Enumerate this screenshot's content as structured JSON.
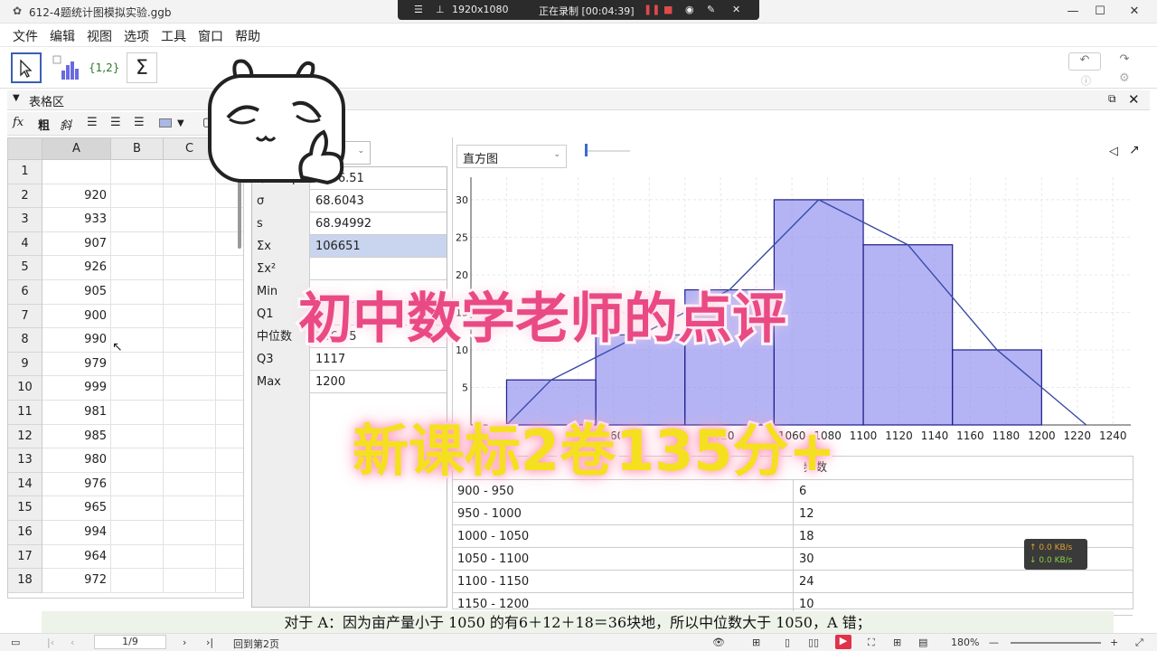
{
  "window": {
    "title": "612-4题统计图模拟实验.ggb",
    "controls": [
      "—",
      "☐",
      "✕"
    ]
  },
  "recording": {
    "resolution": "1920x1080",
    "status": "正在录制 [00:04:39]"
  },
  "menu": [
    "文件",
    "编辑",
    "视图",
    "选项",
    "工具",
    "窗口",
    "帮助"
  ],
  "toolbar": {
    "list_tool_label": "{1,2}",
    "sum_tool_label": "Σ"
  },
  "panel": {
    "title": "表格区",
    "format_fx": "fx",
    "format_bold": "粗",
    "format_italic": "斜"
  },
  "spreadsheet": {
    "columns": [
      "A",
      "B",
      "C"
    ],
    "rows": [
      {
        "n": "1",
        "a": ""
      },
      {
        "n": "2",
        "a": "920"
      },
      {
        "n": "3",
        "a": "933"
      },
      {
        "n": "4",
        "a": "907"
      },
      {
        "n": "5",
        "a": "926"
      },
      {
        "n": "6",
        "a": "905"
      },
      {
        "n": "7",
        "a": "900"
      },
      {
        "n": "8",
        "a": "990"
      },
      {
        "n": "9",
        "a": "979"
      },
      {
        "n": "10",
        "a": "999"
      },
      {
        "n": "11",
        "a": "981"
      },
      {
        "n": "12",
        "a": "985"
      },
      {
        "n": "13",
        "a": "980"
      },
      {
        "n": "14",
        "a": "976"
      },
      {
        "n": "15",
        "a": "965"
      },
      {
        "n": "16",
        "a": "994"
      },
      {
        "n": "17",
        "a": "964"
      },
      {
        "n": "18",
        "a": "972"
      }
    ]
  },
  "stats": [
    {
      "k": "平均数μ",
      "v": "1066.51"
    },
    {
      "k": "σ",
      "v": "68.6043"
    },
    {
      "k": "s",
      "v": "68.94992"
    },
    {
      "k": "Σx",
      "v": "106651"
    },
    {
      "k": "Σx²",
      "v": ""
    },
    {
      "k": "Min",
      "v": ""
    },
    {
      "k": "Q1",
      "v": ""
    },
    {
      "k": "中位数",
      "v": "1066.5"
    },
    {
      "k": "Q3",
      "v": "1117"
    },
    {
      "k": "Max",
      "v": "1200"
    }
  ],
  "graph_panel": {
    "chart_type_select": "直方图"
  },
  "chart_data": {
    "type": "bar",
    "bins": [
      [
        900,
        950
      ],
      [
        950,
        1000
      ],
      [
        1000,
        1050
      ],
      [
        1050,
        1100
      ],
      [
        1100,
        1150
      ],
      [
        1150,
        1200
      ]
    ],
    "values": [
      6,
      12,
      18,
      30,
      24,
      10
    ],
    "polygon_x": [
      900,
      925,
      975,
      1025,
      1075,
      1125,
      1175,
      1225
    ],
    "polygon_y": [
      0,
      6,
      12,
      18,
      30,
      24,
      10,
      0
    ],
    "x_ticks": [
      "960",
      "1020",
      "1060",
      "1080",
      "1100",
      "1120",
      "1140",
      "1160",
      "1180",
      "1200",
      "1220",
      "1240"
    ],
    "y_ticks": [
      "5",
      "10",
      "15",
      "20",
      "25",
      "30"
    ],
    "xlim": [
      880,
      1250
    ],
    "ylim": [
      0,
      33
    ],
    "bar_color": "#8c8cf0"
  },
  "frequency_table": {
    "header_right": "频数",
    "rows": [
      {
        "range": "900 - 950",
        "count": "6"
      },
      {
        "range": "950 - 1000",
        "count": "12"
      },
      {
        "range": "1000 - 1050",
        "count": "18"
      },
      {
        "range": "1050 - 1100",
        "count": "30"
      },
      {
        "range": "1100 - 1150",
        "count": "24"
      },
      {
        "range": "1150 - 1200",
        "count": "10"
      }
    ]
  },
  "overlay": {
    "title": "初中数学老师的点评",
    "subtitle": "新课标2卷135分+"
  },
  "caption": "对于 A：因为亩产量小于 1050 的有6＋12＋18＝36块地，所以中位数大于 1050，A 错；",
  "net": {
    "up": "↑ 0.0 KB/s",
    "down": "↓ 0.0 KB/s"
  },
  "statusbar": {
    "page": "1/9",
    "back_to_page": "回到第2页",
    "zoom": "180%"
  }
}
